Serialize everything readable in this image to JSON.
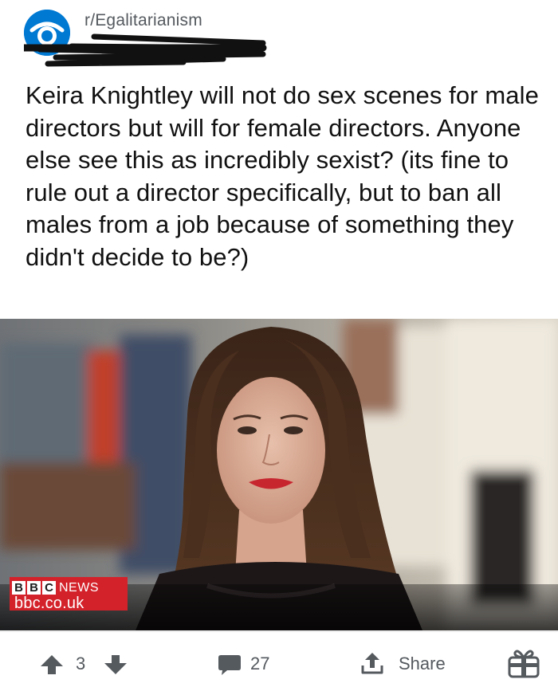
{
  "post": {
    "subreddit": "r/Egalitarianism",
    "title": "Keira Knightley will not do sex scenes for male directors but will for female directors. Anyone else see this as incredibly sexist? (its fine to rule out a director specifically, but to ban all males from a job because of something they didn't decide to be?)"
  },
  "media": {
    "source_logo": [
      "B",
      "B",
      "C"
    ],
    "source_news": "NEWS",
    "source_domain": "bbc.co.uk"
  },
  "actions": {
    "upvote_icon": "arrow-up-icon",
    "vote_count": "3",
    "downvote_icon": "arrow-down-icon",
    "comment_icon": "comment-bubble-icon",
    "comment_count": "27",
    "share_icon": "share-icon",
    "share_label": "Share",
    "award_icon": "gift-icon"
  },
  "colors": {
    "subreddit_icon": "#0079d3",
    "bbc_red": "#d4222a",
    "action_gray": "#555a5f"
  }
}
